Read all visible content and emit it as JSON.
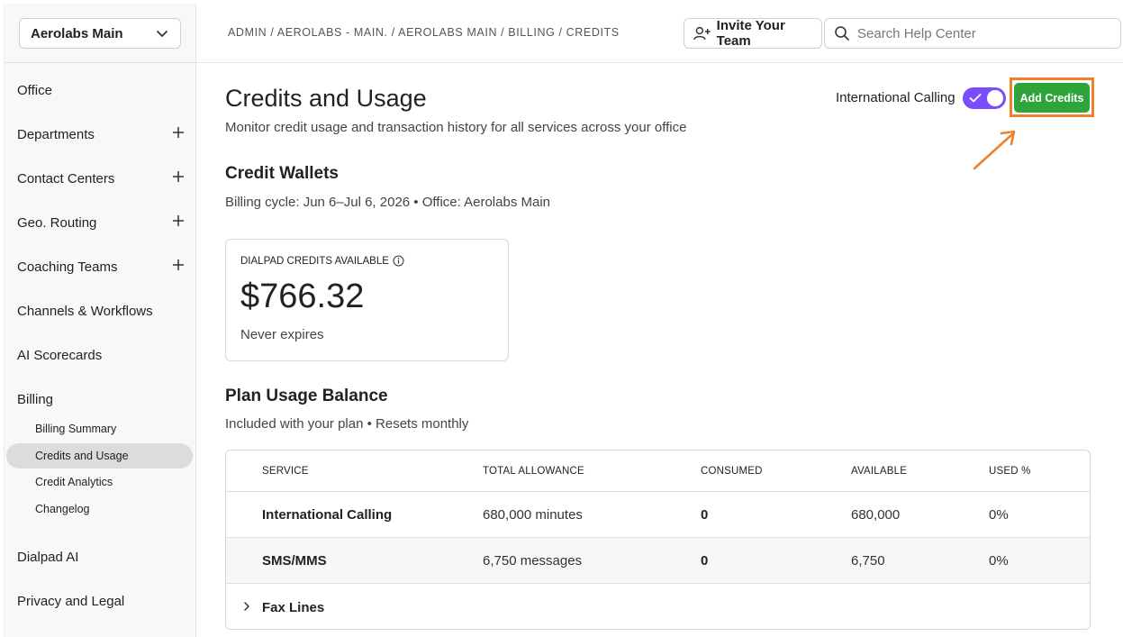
{
  "sidebar": {
    "office_selector": "Aerolabs Main",
    "items": [
      {
        "label": "Office"
      },
      {
        "label": "Departments"
      },
      {
        "label": "Contact Centers"
      },
      {
        "label": "Geo. Routing"
      },
      {
        "label": "Coaching Teams"
      },
      {
        "label": "Channels & Workflows"
      },
      {
        "label": "AI Scorecards"
      },
      {
        "label": "Billing"
      },
      {
        "label": "Dialpad AI"
      },
      {
        "label": "Privacy and Legal"
      }
    ],
    "billing_sub": [
      {
        "label": "Billing Summary"
      },
      {
        "label": "Credits and Usage"
      },
      {
        "label": "Credit Analytics"
      },
      {
        "label": "Changelog"
      }
    ]
  },
  "header": {
    "breadcrumb": "ADMIN / AEROLABS - MAIN. / AEROLABS MAIN / BILLING / CREDITS",
    "invite_label": "Invite Your Team",
    "search_placeholder": "Search Help Center"
  },
  "main": {
    "title": "Credits and Usage",
    "subtitle": "Monitor credit usage and transaction history for all services across your office",
    "intl_calling_label": "International Calling",
    "intl_calling_enabled": true,
    "add_credits_label": "Add Credits",
    "wallets": {
      "title": "Credit Wallets",
      "subtitle": "Billing cycle: Jun 6–Jul 6, 2026 • Office: Aerolabs Main",
      "card_label": "DIALPAD CREDITS AVAILABLE",
      "amount": "$766.32",
      "expiry": "Never expires"
    },
    "plan_usage": {
      "title": "Plan Usage Balance",
      "subtitle": "Included with your plan • Resets monthly",
      "columns": {
        "service": "SERVICE",
        "allowance": "TOTAL ALLOWANCE",
        "consumed": "CONSUMED",
        "available": "AVAILABLE",
        "used": "USED %"
      },
      "rows": [
        {
          "service": "International Calling",
          "allowance": "680,000 minutes",
          "consumed": "0",
          "available": "680,000",
          "used": "0%"
        },
        {
          "service": "SMS/MMS",
          "allowance": "6,750 messages",
          "consumed": "0",
          "available": "6,750",
          "used": "0%"
        },
        {
          "service": "Fax Lines"
        }
      ]
    }
  },
  "colors": {
    "accent_purple": "#7c4dff",
    "add_button_green": "#2ea43a",
    "highlight_orange": "#f0812b"
  }
}
